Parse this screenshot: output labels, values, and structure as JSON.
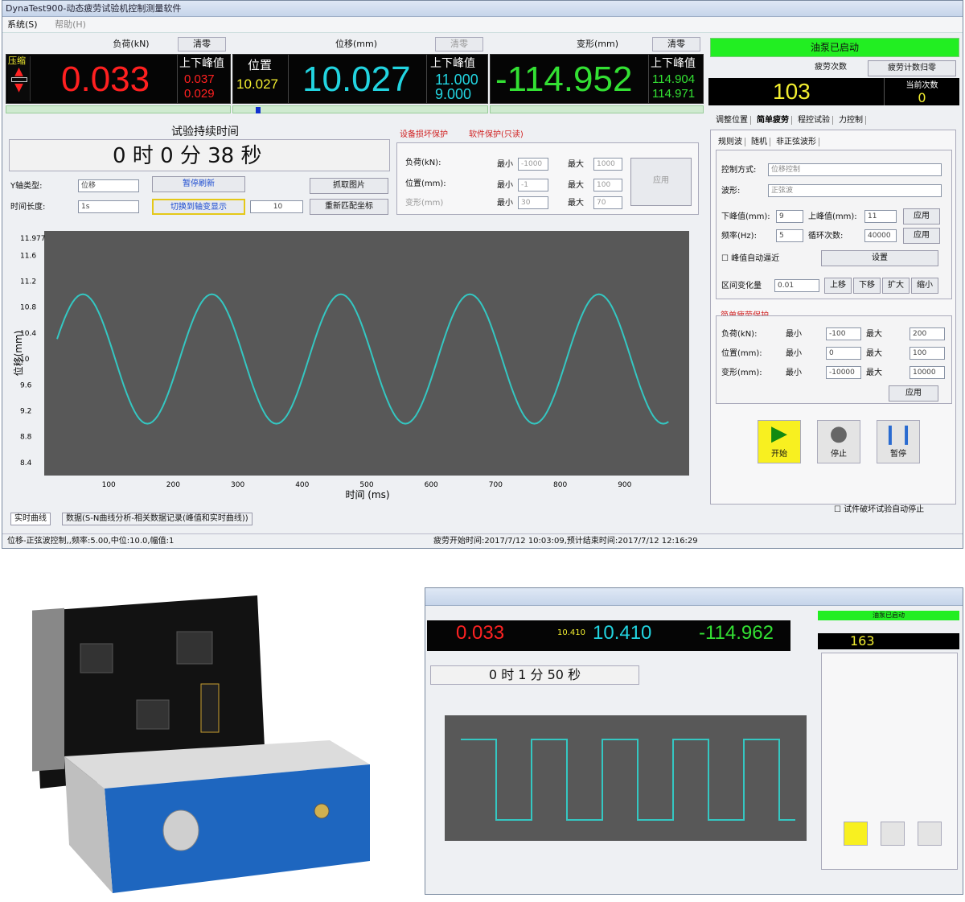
{
  "window": {
    "title": "DynaTest900-动态疲劳试验机控制测量软件"
  },
  "menu": [
    "系统(S)",
    "帮助(H)"
  ],
  "load": {
    "header": "负荷(kN)",
    "clear": "清零",
    "value": "0.033",
    "peak_label": "上下峰值",
    "peak_hi": "0.037",
    "peak_lo": "0.029",
    "status": "压缩"
  },
  "position": {
    "header": "位移(mm)",
    "clear": "清零",
    "pos_label": "位置",
    "pos_value": "10.027",
    "value": "10.027",
    "peak_label": "上下峰值",
    "peak_hi": "11.000",
    "peak_lo": "9.000"
  },
  "strain": {
    "header": "变形(mm)",
    "clear": "清零",
    "value": "-114.952",
    "peak_label": "上下峰值",
    "peak_hi": "114.904",
    "peak_lo": "114.971"
  },
  "right_top": {
    "status": "油泵已启动",
    "cycle_label": "疲劳次数",
    "cycle_stop_label": "疲劳计数归零",
    "cycles": "103",
    "current_label": "当前次数",
    "current": "0"
  },
  "duration": {
    "label": "试验持续时间",
    "value": "0 时 0 分 38 秒"
  },
  "controls_left": {
    "axis_label": "Y轴类型:",
    "axis_value": "位移",
    "pause_btn": "暂停刷新",
    "time_label": "时间长度:",
    "time_value": "1s",
    "switch_btn": "切换到轴变显示",
    "capture_btn": "抓取图片",
    "rescale_btn": "重新匹配坐标",
    "rescale_value": "10"
  },
  "protection": {
    "tab1": "设备损坏保护",
    "tab2": "软件保护(只读)",
    "rows": [
      {
        "label": "负荷(kN):",
        "min_label": "最小",
        "min": "-1000",
        "max_label": "最大",
        "max": "1000"
      },
      {
        "label": "位置(mm):",
        "min_label": "最小",
        "min": "-1",
        "max_label": "最大",
        "max": "100"
      },
      {
        "label": "变形(mm)",
        "min_label": "最小",
        "min": "30",
        "max_label": "最大",
        "max": "70"
      }
    ],
    "apply": "应用"
  },
  "chart_data": {
    "type": "line",
    "xlabel": "时间 (ms)",
    "ylabel": "位移(mm)",
    "xlim": [
      0,
      1000
    ],
    "ylim": [
      8.2,
      11.977
    ],
    "ytick_top": "11.977",
    "yticks": [
      "11.6",
      "11.2",
      "10.8",
      "10.4",
      "10",
      "9.6",
      "9.2",
      "8.8",
      "8.4"
    ],
    "xticks": [
      "100",
      "200",
      "300",
      "400",
      "500",
      "600",
      "700",
      "800",
      "900"
    ],
    "series": [
      {
        "color": "#34c7c2",
        "amplitude": 1.0,
        "center": 10.0,
        "frequency_hz": 5.0
      }
    ],
    "grid": false
  },
  "tabs_bottom": {
    "t1": "实时曲线",
    "t2": "数据(S-N曲线分析-相关数据记录(峰值和实时曲线))"
  },
  "right_panel": {
    "tabs": [
      "调整位置",
      "简单疲劳",
      "程控试验",
      "力控制"
    ],
    "subtabs": [
      "规则波",
      "随机",
      "非正弦波形"
    ],
    "control_label": "控制方式:",
    "control_value": "位移控制",
    "wave_label": "波形:",
    "wave_value": "正弦波",
    "lower_label": "下峰值(mm):",
    "lower_value": "9",
    "upper_label": "上峰值(mm):",
    "upper_value": "11",
    "apply1": "应用",
    "freq_label": "频率(Hz):",
    "freq_value": "5",
    "cycles_label": "循环次数:",
    "cycles_value": "40000",
    "apply2": "应用",
    "auto_label": "峰值自动逼近",
    "set_btn": "设置",
    "range_label": "区间变化量",
    "range_value": "0.01",
    "move_btns": [
      "上移",
      "下移",
      "扩大",
      "缩小"
    ],
    "prot_title": "简单疲劳保护",
    "prot_rows": [
      {
        "label": "负荷(kN):",
        "min_label": "最小",
        "min": "-100",
        "max_label": "最大",
        "max": "200"
      },
      {
        "label": "位置(mm):",
        "min_label": "最小",
        "min": "0",
        "max_label": "最大",
        "max": "100"
      },
      {
        "label": "变形(mm):",
        "min_label": "最小",
        "min": "-10000",
        "max_label": "最大",
        "max": "10000"
      }
    ],
    "prot_apply": "应用",
    "start": "开始",
    "stop": "停止",
    "pause": "暂停",
    "auto_stop": "试件破坏试验自动停止"
  },
  "statusbar": {
    "left": "位移-正弦波控制,,频率:5.00,中位:10.0,幅值:1",
    "right": "疲劳开始时间:2017/7/12 10:03:09,预计结束时间:2017/7/12 12:16:29"
  },
  "second": {
    "load_value": "0.033",
    "pos_value": "10.410",
    "pos_small": "10.410",
    "strain_value": "-114.962",
    "cycles": "163",
    "duration": "0 时 1 分 50 秒",
    "status": "油泵已启动"
  }
}
